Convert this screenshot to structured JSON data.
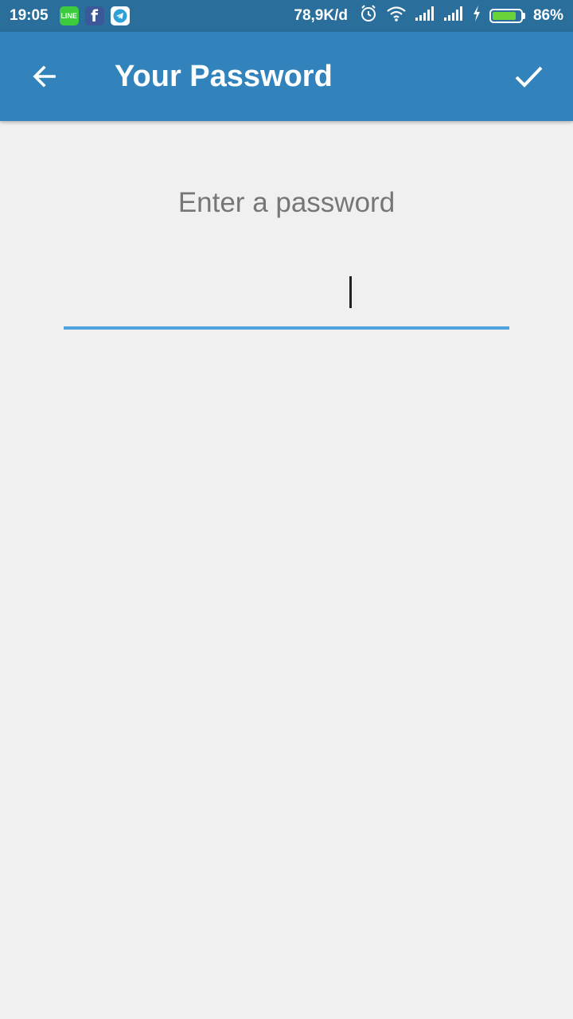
{
  "status_bar": {
    "time": "19:05",
    "apps": [
      {
        "name": "line-icon",
        "label": "LINE"
      },
      {
        "name": "facebook-icon",
        "label": "f"
      },
      {
        "name": "telegram-icon",
        "label": ""
      }
    ],
    "network_speed": "78,9K/d",
    "battery_percent": "86%",
    "battery_level": 0.86
  },
  "app_bar": {
    "title": "Your Password",
    "background": "#3283bc"
  },
  "main": {
    "prompt": "Enter a password",
    "password_value": "",
    "accent": "#4da3df"
  }
}
